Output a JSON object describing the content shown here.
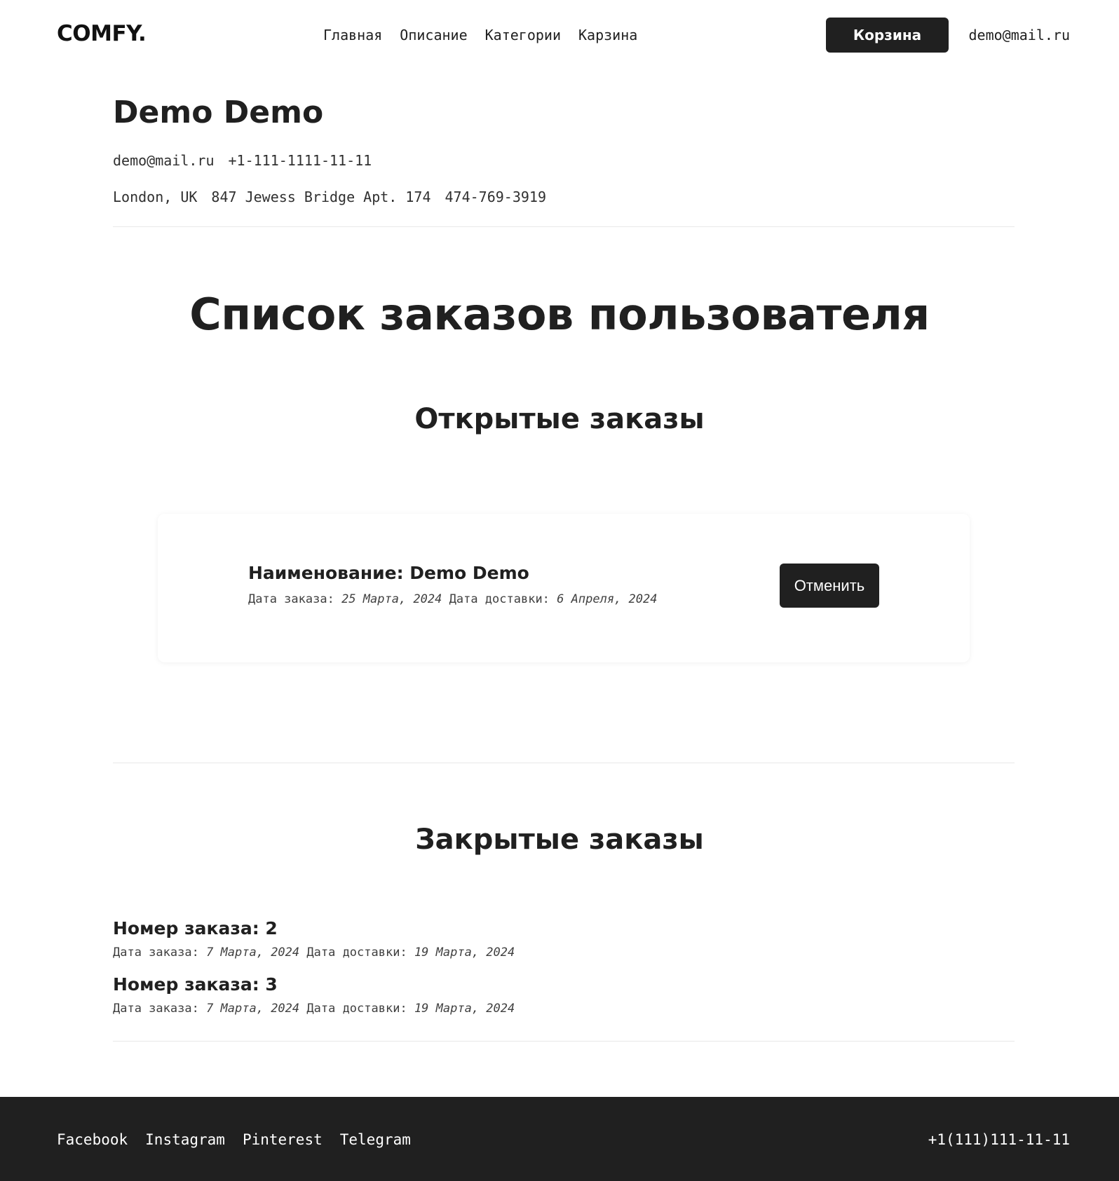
{
  "header": {
    "logo": "COMFY.",
    "nav": [
      "Главная",
      "Описание",
      "Категории",
      "Карзина"
    ],
    "cart_button": "Корзина",
    "user_email": "demo@mail.ru"
  },
  "profile": {
    "name": "Demo Demo",
    "email": "demo@mail.ru",
    "phone": "+1-111-1111-11-11",
    "city": "London, UK",
    "address": "847 Jewess Bridge Apt. 174",
    "address_phone": "474-769-3919"
  },
  "page_title": "Список заказов пользователя",
  "open_orders": {
    "title": "Открытые заказы",
    "items": [
      {
        "name": "Наименование: Demo Demo",
        "order_date_label": "Дата заказа:",
        "order_date": "25 Марта, 2024",
        "delivery_date_label": "Дата доставки:",
        "delivery_date": "6 Апреля, 2024",
        "cancel_label": "Отменить"
      }
    ]
  },
  "closed_orders": {
    "title": "Закрытые заказы",
    "items": [
      {
        "number": "Номер заказа: 2",
        "order_date_label": "Дата заказа:",
        "order_date": "7 Марта, 2024",
        "delivery_date_label": "Дата доставки:",
        "delivery_date": "19 Марта, 2024"
      },
      {
        "number": "Номер заказа: 3",
        "order_date_label": "Дата заказа:",
        "order_date": "7 Марта, 2024",
        "delivery_date_label": "Дата доставки:",
        "delivery_date": "19 Марта, 2024"
      }
    ]
  },
  "footer": {
    "links": [
      "Facebook",
      "Instagram",
      "Pinterest",
      "Telegram"
    ],
    "phone": "+1(111)111-11-11"
  },
  "colors": {
    "primary_dark": "#202020",
    "background": "#ffffff",
    "divider": "#e8e8e8"
  }
}
